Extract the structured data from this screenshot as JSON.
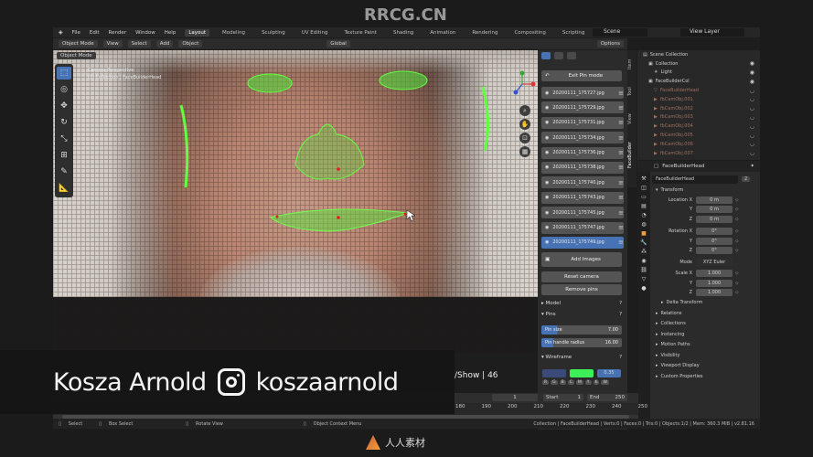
{
  "watermark": {
    "top": "RRCG.CN",
    "bottom_text": "人人素材"
  },
  "topbar": {
    "menus": [
      "File",
      "Edit",
      "Render",
      "Window",
      "Help"
    ],
    "tabs": [
      "Layout",
      "Modeling",
      "Sculpting",
      "UV Editing",
      "Texture Paint",
      "Shading",
      "Animation",
      "Rendering",
      "Compositing",
      "Scripting"
    ],
    "active_tab": "Layout",
    "scene": "Scene",
    "view_layer": "View Layer"
  },
  "header3d": {
    "mode": "Object Mode",
    "menus": [
      "View",
      "Select",
      "Add",
      "Object"
    ],
    "orientation": "Global",
    "options": "Options"
  },
  "viewport": {
    "info_line1": "Camera Perspective",
    "info_line2": "(1) Collection | FaceBuilderHead"
  },
  "npanel": {
    "tabs": [
      "Item",
      "Tool",
      "View",
      "FaceBuilder"
    ],
    "exit_button": "Exit Pin mode",
    "images": [
      "20200111_175727.jpg",
      "20200111_175729.jpg",
      "20200111_175731.jpg",
      "20200111_175734.jpg",
      "20200111_175736.jpg",
      "20200111_175738.jpg",
      "20200111_175740.jpg",
      "20200111_175743.jpg",
      "20200111_175745.jpg",
      "20200111_175747.jpg",
      "20200111_175749.jpg"
    ],
    "active_image_index": 10,
    "add_images": "Add Images",
    "reset_camera": "Reset camera",
    "remove_pins": "Remove pins",
    "sections": {
      "model": "Model",
      "pins": "Pins",
      "wireframe": "Wireframe"
    },
    "pin_size_label": "Pin size",
    "pin_size_value": "7.00",
    "handle_radius_label": "Pin handle radius",
    "handle_radius_value": "16.00",
    "wire_opacity": "0.35",
    "wire_color_a": "#3c4a7a",
    "wire_color_b": "#3ef058",
    "letters": [
      "R",
      "G",
      "B",
      "C",
      "M",
      "Y",
      "K",
      "W"
    ]
  },
  "outliner": {
    "scene_collection": "Scene Collection",
    "rows": [
      {
        "label": "Collection",
        "dim": false
      },
      {
        "label": "Light",
        "dim": false
      },
      {
        "label": "FaceBuilderCol",
        "dim": false
      },
      {
        "label": "FaceBuilderHead",
        "dim": true
      },
      {
        "label": "fbCamObj.001",
        "dim": true
      },
      {
        "label": "fbCamObj.002",
        "dim": true
      },
      {
        "label": "fbCamObj.003",
        "dim": true
      },
      {
        "label": "fbCamObj.004",
        "dim": true
      },
      {
        "label": "fbCamObj.005",
        "dim": true
      },
      {
        "label": "fbCamObj.006",
        "dim": true
      },
      {
        "label": "fbCamObj.007",
        "dim": true
      }
    ]
  },
  "properties": {
    "header_object": "FaceBuilderHead",
    "object_name": "FaceBuilderHead",
    "user_count": "2",
    "transform": "Transform",
    "location_label": "Location X",
    "location": [
      "0 m",
      "0 m",
      "0 m"
    ],
    "rotation_label": "Rotation X",
    "rotation": [
      "0°",
      "0°",
      "0°"
    ],
    "mode_label": "Mode",
    "mode_value": "XYZ Euler",
    "scale_label": "Scale X",
    "scale": [
      "1.000",
      "1.000",
      "1.000"
    ],
    "axis_labels": [
      "Y",
      "Z"
    ],
    "subsections": [
      "Delta Transform",
      "Relations",
      "Collections",
      "Instancing",
      "Motion Paths",
      "Visibility",
      "Viewport Display",
      "Custom Properties"
    ]
  },
  "timeline": {
    "current_frame": "1",
    "start_label": "Start",
    "start": "1",
    "end_label": "End",
    "end": "250",
    "ticks": [
      "180",
      "190",
      "200",
      "210",
      "220",
      "230",
      "240",
      "250"
    ]
  },
  "statusbar": {
    "select": "Select",
    "box_select": "Box Select",
    "rotate_view": "Rotate View",
    "context_menu": "Object Context Menu",
    "stats": "Collection | FaceBuilderHead | Verts:0 | Faces:0 | Tris:0 | Objects:1/2 | Mem: 360.3 MiB | v2.81.16"
  },
  "lower_third": {
    "name": "Kosza Arnold",
    "handle": "koszaarnold",
    "slide_text": "/Show | 46"
  }
}
